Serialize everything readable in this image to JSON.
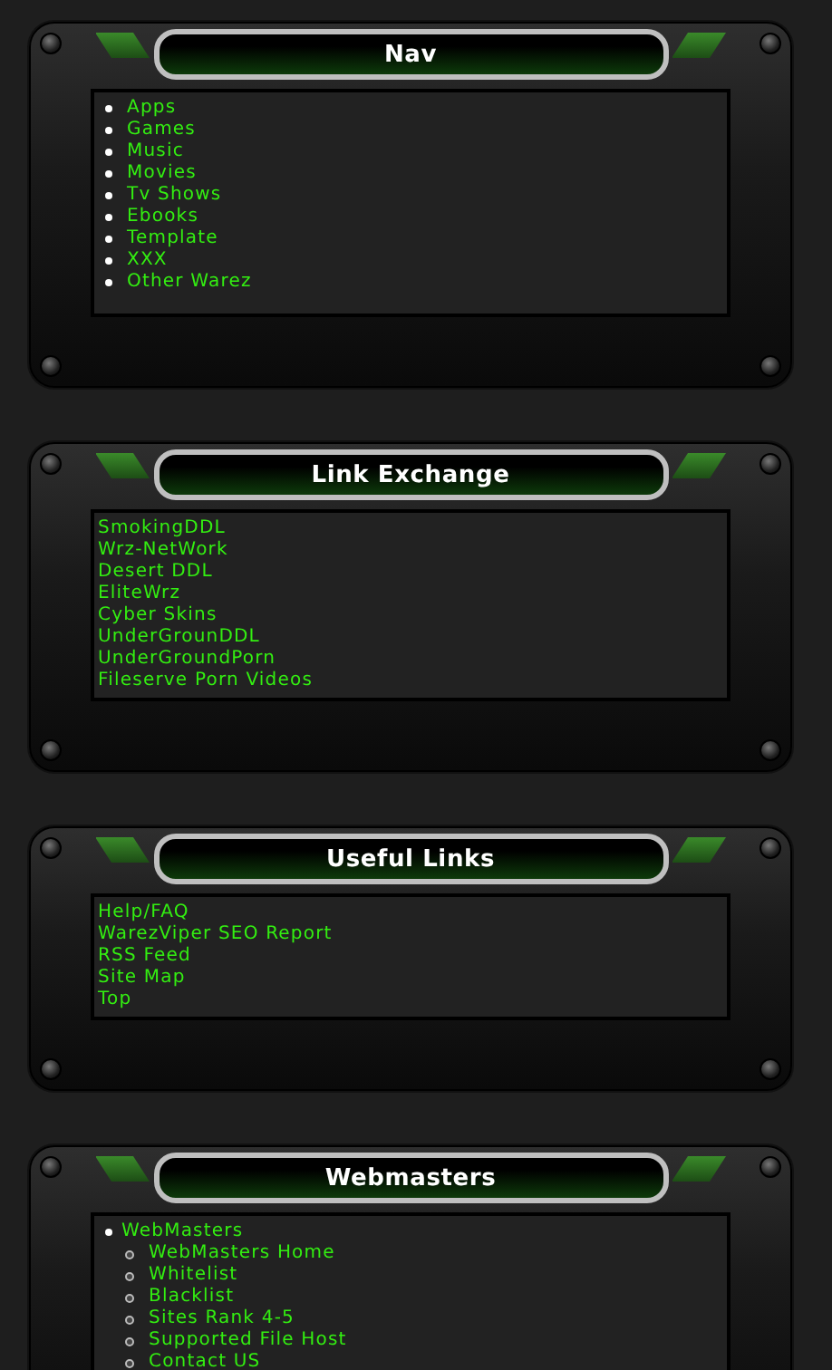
{
  "panels": [
    {
      "title": "Nav",
      "kind": "bullets",
      "items": [
        {
          "label": "Apps"
        },
        {
          "label": "Games"
        },
        {
          "label": "Music"
        },
        {
          "label": "Movies"
        },
        {
          "label": "Tv Shows"
        },
        {
          "label": "Ebooks"
        },
        {
          "label": "Template"
        },
        {
          "label": "XXX"
        },
        {
          "label": "Other Warez"
        }
      ]
    },
    {
      "title": "Link Exchange",
      "kind": "plain",
      "items": [
        {
          "label": "SmokingDDL"
        },
        {
          "label": "Wrz-NetWork"
        },
        {
          "label": "Desert DDL"
        },
        {
          "label": "EliteWrz"
        },
        {
          "label": "Cyber Skins"
        },
        {
          "label": "UnderGrounDDL"
        },
        {
          "label": "UnderGroundPorn"
        },
        {
          "label": "Fileserve Porn Videos"
        }
      ]
    },
    {
      "title": "Useful Links",
      "kind": "plain",
      "items": [
        {
          "label": "Help/FAQ"
        },
        {
          "label": "WarezViper SEO Report"
        },
        {
          "label": "RSS Feed"
        },
        {
          "label": "Site Map"
        },
        {
          "label": "Top"
        }
      ]
    },
    {
      "title": "Webmasters",
      "kind": "tree",
      "items": [
        {
          "label": "WebMasters",
          "children": [
            {
              "label": "WebMasters Home"
            },
            {
              "label": "Whitelist"
            },
            {
              "label": "Blacklist"
            },
            {
              "label": "Sites Rank 4-5"
            },
            {
              "label": "Supported File Host"
            },
            {
              "label": "Contact US"
            }
          ]
        }
      ]
    }
  ]
}
